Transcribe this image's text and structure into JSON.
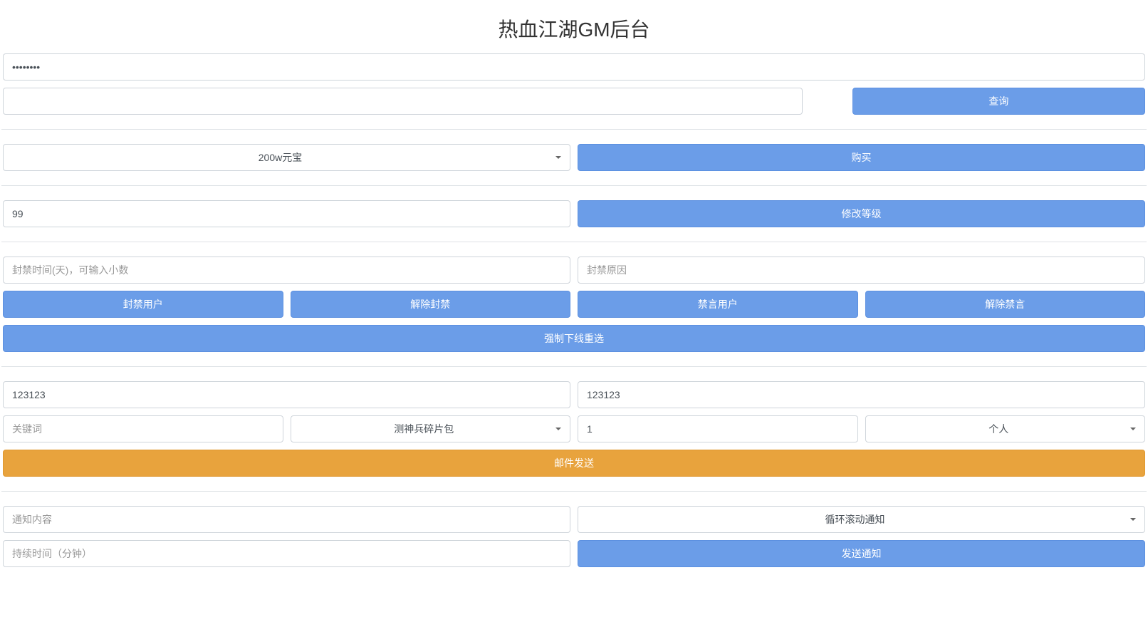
{
  "page_title": "热血江湖GM后台",
  "password_input": {
    "value": "",
    "placeholder": ""
  },
  "query_section": {
    "input_value": "",
    "button_label": "查询"
  },
  "purchase_section": {
    "select_value": "200w元宝",
    "button_label": "购买"
  },
  "level_section": {
    "input_value": "99",
    "button_label": "修改等级"
  },
  "ban_section": {
    "ban_time_placeholder": "封禁时间(天)，可输入小数",
    "ban_reason_placeholder": "封禁原因",
    "ban_user_label": "封禁用户",
    "unban_user_label": "解除封禁",
    "mute_user_label": "禁言用户",
    "unmute_user_label": "解除禁言",
    "force_offline_label": "强制下线重选"
  },
  "mail_section": {
    "input1_value": "123123",
    "input2_value": "123123",
    "keyword_placeholder": "关键词",
    "item_select_value": "测神兵碎片包",
    "count_value": "1",
    "target_select_value": "个人",
    "send_mail_label": "邮件发送"
  },
  "notify_section": {
    "content_placeholder": "通知内容",
    "type_select_value": "循环滚动通知",
    "duration_placeholder": "持续时间（分钟）",
    "send_notify_label": "发送通知"
  }
}
